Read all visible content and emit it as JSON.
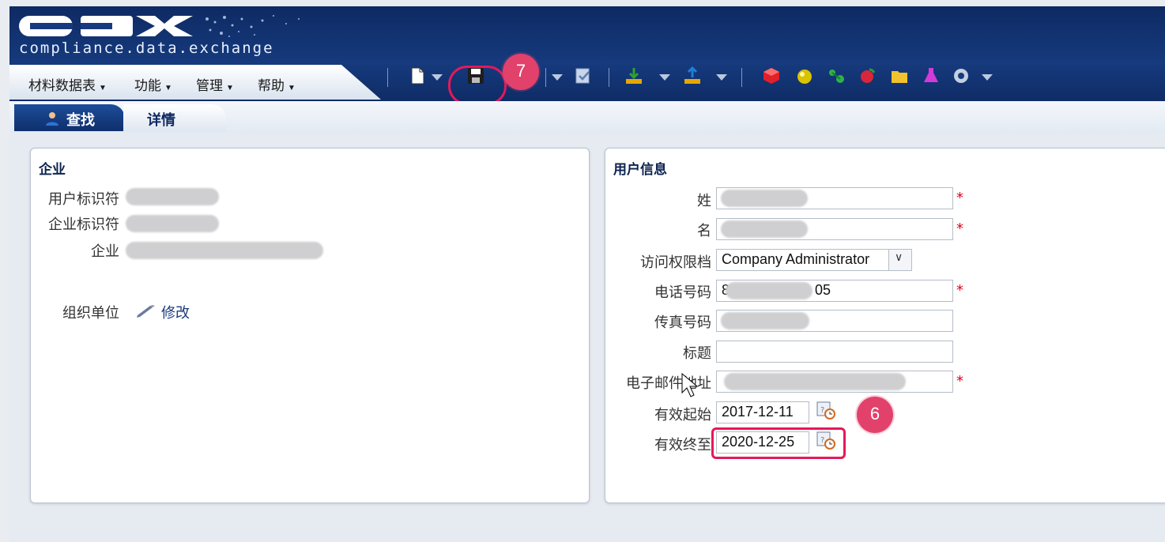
{
  "logo": {
    "brand": "CDX",
    "subtitle": "compliance.data.exchange"
  },
  "menu": [
    "材料数据表",
    "功能",
    "管理",
    "帮助"
  ],
  "toolbar": {
    "icons": [
      "new-document-icon",
      "save-icon",
      "check-icon",
      "download-icon",
      "upload-icon",
      "red-cube-icon",
      "yellow-sphere-icon",
      "green-molecule-icon",
      "red-apple-icon",
      "folder-icon",
      "flask-icon",
      "gear-icon"
    ]
  },
  "tabs": {
    "find": "查找",
    "detail": "详情"
  },
  "company_panel": {
    "title": "企业",
    "labels": {
      "user_id": "用户标识符",
      "company_id": "企业标识符",
      "company": "企业",
      "org_unit": "组织单位"
    },
    "edit_label": "修改"
  },
  "user_panel": {
    "title": "用户信息",
    "labels": {
      "last_name": "姓",
      "first_name": "名",
      "access_profile": "访问权限档",
      "phone": "电话号码",
      "fax": "传真号码",
      "title": "标题",
      "email": "电子邮件地址",
      "valid_from": "有效起始",
      "valid_to": "有效终至"
    },
    "access_profile_value": "Company Administrator",
    "phone_prefix": "8",
    "phone_suffix": "05",
    "valid_from_value": "2017-12-11",
    "valid_to_value": "2020-12-25",
    "required_mark": "*"
  },
  "annotations": {
    "badge6": "6",
    "badge7": "7"
  },
  "colors": {
    "header": "#0e2a63",
    "badge": "#e2416b",
    "required": "#e0001b"
  }
}
